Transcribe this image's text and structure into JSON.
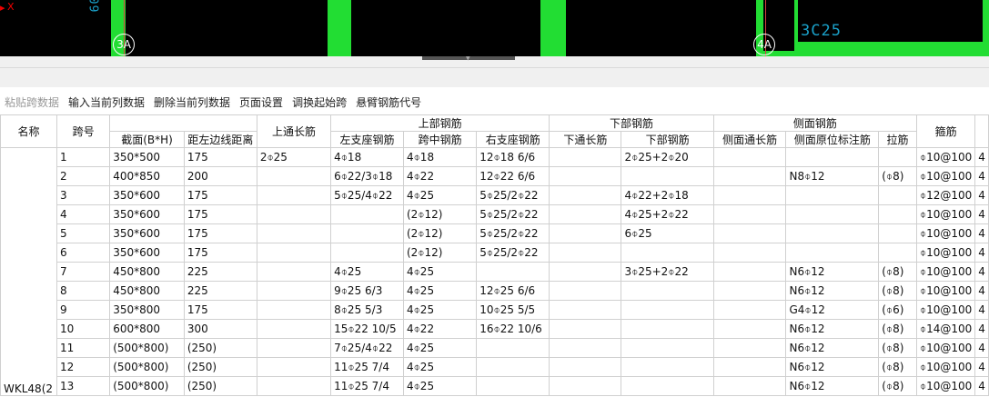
{
  "cad": {
    "axis_marker": "X",
    "top_text": "60",
    "beam_label": "3C25",
    "grid_labels": [
      "3A",
      "4A"
    ]
  },
  "toolbar": {
    "items": [
      "粘贴跨数据",
      "输入当前列数据",
      "删除当前列数据",
      "页面设置",
      "调换起始跨",
      "悬臂钢筋代号"
    ]
  },
  "table": {
    "group_headers": {
      "name": "名称",
      "span": "跨号",
      "top_rebar": "上部钢筋",
      "bottom_rebar": "下部钢筋",
      "side_rebar": "侧面钢筋",
      "stirrup": "箍筋",
      "top_through": "上通长筋"
    },
    "sub_headers": {
      "section": "截面(B*H)",
      "edge_distance": "距左边线距离",
      "left_support": "左支座钢筋",
      "mid_span": "跨中钢筋",
      "right_support": "右支座钢筋",
      "bottom_through": "下通长筋",
      "bottom": "下部钢筋",
      "side_through": "侧面通长筋",
      "side_original": "侧面原位标注筋",
      "tie": "拉筋"
    },
    "beam_name": "WKL48(2",
    "rows": [
      {
        "span": "1",
        "section": "350*500",
        "dist": "175",
        "top_through": "2⌽25",
        "left": "4⌽18",
        "mid": "4⌽18",
        "right": "12⌽18 6/6",
        "bot_through": "",
        "bottom": "2⌽25+2⌽20",
        "side_through": "",
        "side_orig": "",
        "tie": "",
        "stirrup": "⌽10@100",
        "extra": "4"
      },
      {
        "span": "2",
        "section": "400*850",
        "dist": "200",
        "top_through": "",
        "left": "6⌽22/3⌽18",
        "mid": "4⌽22",
        "right": "12⌽22 6/6",
        "bot_through": "",
        "bottom": "",
        "side_through": "",
        "side_orig": "N8⌽12",
        "tie": "(⌽8)",
        "stirrup": "⌽10@100",
        "extra": "4"
      },
      {
        "span": "3",
        "section": "350*600",
        "dist": "175",
        "top_through": "",
        "left": "5⌽25/4⌽22",
        "mid": "4⌽25",
        "right": "5⌽25/2⌽22",
        "bot_through": "",
        "bottom": "4⌽22+2⌽18",
        "side_through": "",
        "side_orig": "",
        "tie": "",
        "stirrup": "⌽12@100",
        "extra": "4"
      },
      {
        "span": "4",
        "section": "350*600",
        "dist": "175",
        "top_through": "",
        "left": "",
        "mid": "(2⌽12)",
        "right": "5⌽25/2⌽22",
        "bot_through": "",
        "bottom": "4⌽25+2⌽22",
        "side_through": "",
        "side_orig": "",
        "tie": "",
        "stirrup": "⌽10@100",
        "extra": "4"
      },
      {
        "span": "5",
        "section": "350*600",
        "dist": "175",
        "top_through": "",
        "left": "",
        "mid": "(2⌽12)",
        "right": "5⌽25/2⌽22",
        "bot_through": "",
        "bottom": "6⌽25",
        "side_through": "",
        "side_orig": "",
        "tie": "",
        "stirrup": "⌽10@100",
        "extra": "4"
      },
      {
        "span": "6",
        "section": "350*600",
        "dist": "175",
        "top_through": "",
        "left": "",
        "mid": "(2⌽12)",
        "right": "5⌽25/2⌽22",
        "bot_through": "",
        "bottom": "",
        "side_through": "",
        "side_orig": "",
        "tie": "",
        "stirrup": "⌽10@100",
        "extra": "4"
      },
      {
        "span": "7",
        "section": "450*800",
        "dist": "225",
        "top_through": "",
        "left": "4⌽25",
        "mid": "4⌽25",
        "right": "",
        "bot_through": "",
        "bottom": "3⌽25+2⌽22",
        "side_through": "",
        "side_orig": "N6⌽12",
        "tie": "(⌽8)",
        "stirrup": "⌽10@100",
        "extra": "4"
      },
      {
        "span": "8",
        "section": "450*800",
        "dist": "225",
        "top_through": "",
        "left": "9⌽25 6/3",
        "mid": "4⌽25",
        "right": "12⌽25 6/6",
        "bot_through": "",
        "bottom": "",
        "side_through": "",
        "side_orig": "N6⌽12",
        "tie": "(⌽8)",
        "stirrup": "⌽10@100",
        "extra": "4"
      },
      {
        "span": "9",
        "section": "350*800",
        "dist": "175",
        "top_through": "",
        "left": "8⌽25 5/3",
        "mid": "4⌽25",
        "right": "10⌽25 5/5",
        "bot_through": "",
        "bottom": "",
        "side_through": "",
        "side_orig": "G4⌽12",
        "tie": "(⌽6)",
        "stirrup": "⌽10@100",
        "extra": "4"
      },
      {
        "span": "10",
        "section": "600*800",
        "dist": "300",
        "top_through": "",
        "left": "15⌽22 10/5",
        "mid": "4⌽22",
        "right": "16⌽22 10/6",
        "bot_through": "",
        "bottom": "",
        "side_through": "",
        "side_orig": "N6⌽12",
        "tie": "(⌽8)",
        "stirrup": "⌽14@100",
        "extra": "4"
      },
      {
        "span": "11",
        "section": "(500*800)",
        "dist": "(250)",
        "top_through": "",
        "left": "7⌽25/4⌽22",
        "mid": "4⌽25",
        "right": "",
        "bot_through": "",
        "bottom": "",
        "side_through": "",
        "side_orig": "N6⌽12",
        "tie": "(⌽8)",
        "stirrup": "⌽10@100",
        "extra": "4"
      },
      {
        "span": "12",
        "section": "(500*800)",
        "dist": "(250)",
        "top_through": "",
        "left": "11⌽25 7/4",
        "mid": "4⌽25",
        "right": "",
        "bot_through": "",
        "bottom": "",
        "side_through": "",
        "side_orig": "N6⌽12",
        "tie": "(⌽8)",
        "stirrup": "⌽10@100",
        "extra": "4"
      },
      {
        "span": "13",
        "section": "(500*800)",
        "dist": "(250)",
        "top_through": "",
        "left": "11⌽25 7/4",
        "mid": "4⌽25",
        "right": "",
        "bot_through": "",
        "bottom": "",
        "side_through": "",
        "side_orig": "N6⌽12",
        "tie": "(⌽8)",
        "stirrup": "⌽10@100",
        "extra": "4"
      }
    ]
  }
}
